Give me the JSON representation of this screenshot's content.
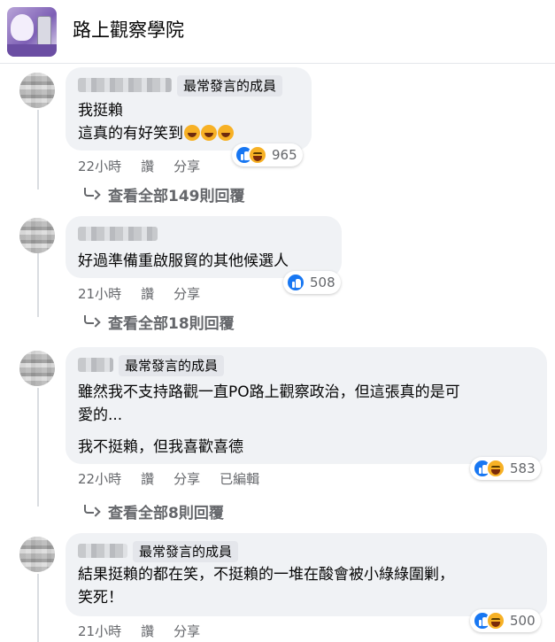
{
  "group": {
    "title": "路上觀察學院"
  },
  "comments": [
    {
      "badge": "最常發言的成員",
      "lines": [
        "我挺賴",
        "這真的有好笑到"
      ],
      "emoji": [
        "rolling-laughing-emoji",
        "rolling-laughing-emoji",
        "rolling-laughing-emoji"
      ],
      "reaction_count": "965",
      "reactions": [
        "like-icon",
        "haha-icon"
      ],
      "time": "22小時",
      "like": "讚",
      "reply": "分享",
      "view_replies": "查看全部149則回覆"
    },
    {
      "badge": "",
      "lines": [
        "好過準備重啟服貿的其他候選人"
      ],
      "reaction_count": "508",
      "reactions": [
        "like-icon"
      ],
      "time": "21小時",
      "like": "讚",
      "reply": "分享",
      "view_replies": "查看全部18則回覆"
    },
    {
      "badge": "最常發言的成員",
      "lines": [
        "雖然我不支持路觀一直PO路上觀察政治，但這張真的是可",
        "愛的...",
        "我不挺賴，但我喜歡喜德"
      ],
      "reaction_count": "583",
      "reactions": [
        "like-icon",
        "haha-icon"
      ],
      "time": "22小時",
      "like": "讚",
      "reply": "分享",
      "edited": "已編輯",
      "view_replies": "查看全部8則回覆"
    },
    {
      "badge": "最常發言的成員",
      "lines": [
        "結果挺賴的都在笑，不挺賴的一堆在酸會被小綠綠圍剿，",
        "笑死！"
      ],
      "reaction_count": "500",
      "reactions": [
        "like-icon",
        "haha-icon"
      ],
      "time": "21小時",
      "like": "讚",
      "reply": "分享"
    }
  ],
  "colors": {
    "bubble": "#f0f2f5",
    "secondary_text": "#65676b",
    "like_blue": "#1877f2",
    "haha_yellow": "#f7b125"
  }
}
